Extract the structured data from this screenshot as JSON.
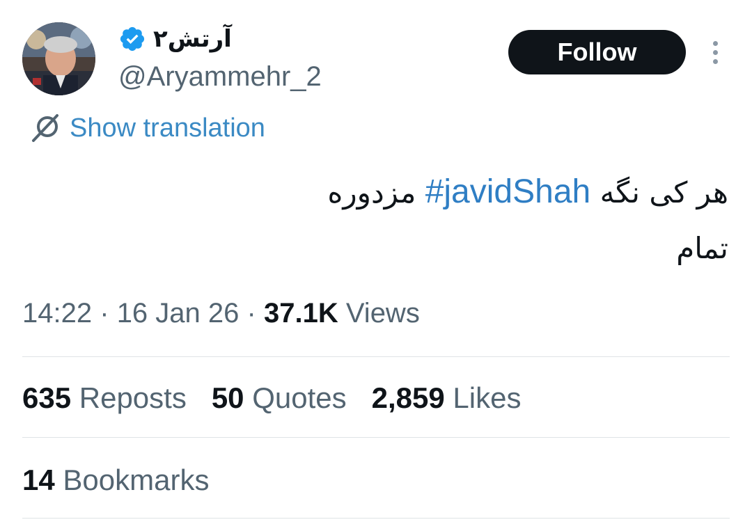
{
  "author": {
    "display_name": "آرتش۲",
    "handle": "@Aryammehr_2",
    "verified_icon": "verified-badge-icon",
    "avatar_icon": "profile-photo"
  },
  "actions": {
    "follow_label": "Follow",
    "more_icon": "more-vertical-icon"
  },
  "translation": {
    "label": "Show translation",
    "icon": "translate-globe-icon"
  },
  "tweet": {
    "text_before": "هر کی نگه",
    "hashtag": "#javidShah",
    "text_after": "مزدوره",
    "line2": "تمام"
  },
  "meta": {
    "time": "14:22",
    "sep1": "·",
    "date": "16 Jan 26",
    "sep2": "·",
    "views_count": "37.1K",
    "views_label": "Views"
  },
  "stats": {
    "reposts_count": "635",
    "reposts_label": "Reposts",
    "quotes_count": "50",
    "quotes_label": "Quotes",
    "likes_count": "2,859",
    "likes_label": "Likes"
  },
  "bookmarks": {
    "count": "14",
    "label": "Bookmarks"
  },
  "colors": {
    "link": "#2f7ec4",
    "text": "#0f1419",
    "secondary": "#536471",
    "verified": "#1d9bf0",
    "button": "#0f1419"
  }
}
